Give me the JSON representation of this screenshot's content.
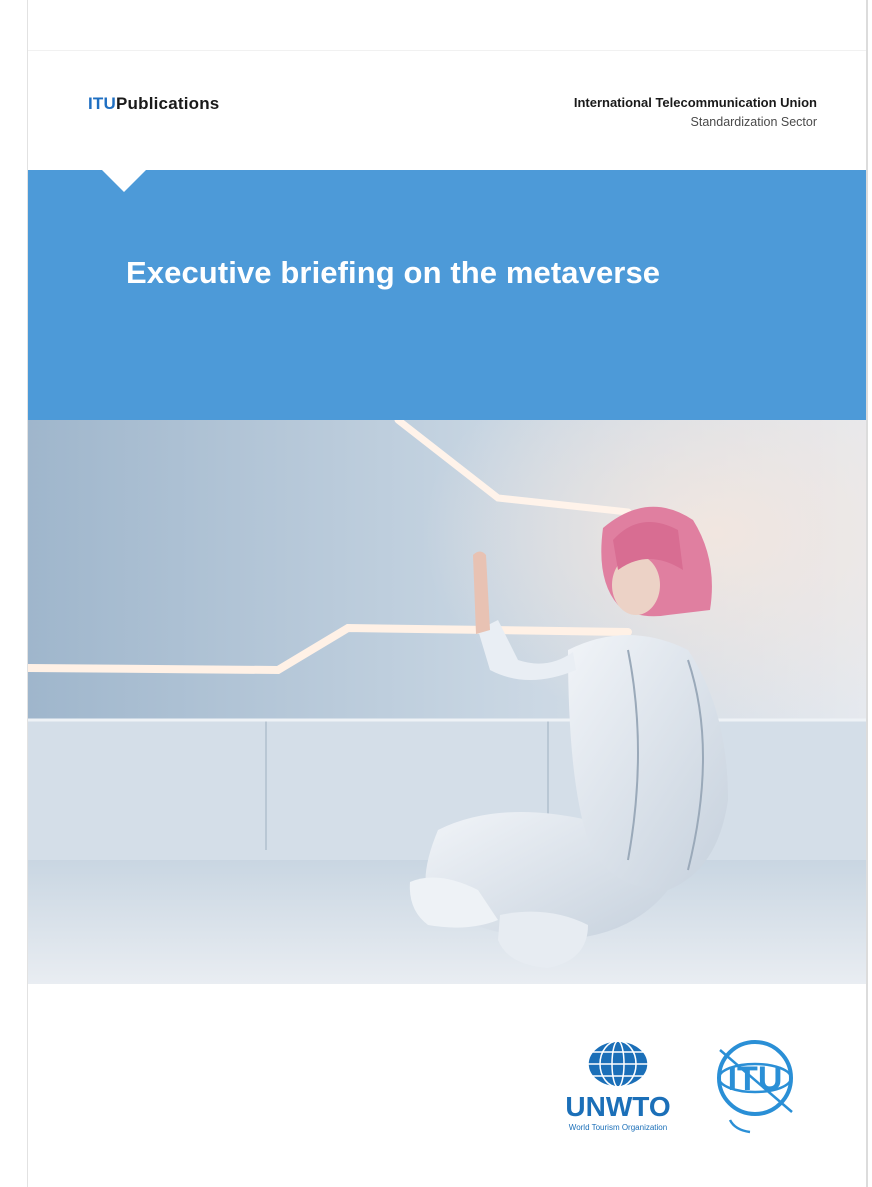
{
  "header": {
    "brand_prefix": "ITU",
    "brand_suffix": "Publications",
    "org_name": "International Telecommunication Union",
    "org_sector": "Standardization Sector"
  },
  "banner": {
    "title": "Executive briefing on the metaverse",
    "color": "#4d9ad8"
  },
  "logos": {
    "unwto_name": "UNWTO",
    "unwto_full": "World Tourism Organization",
    "itu_name": "ITU"
  },
  "colors": {
    "accent_blue": "#1f6fc2",
    "itu_logo_blue": "#2a8fd6"
  }
}
